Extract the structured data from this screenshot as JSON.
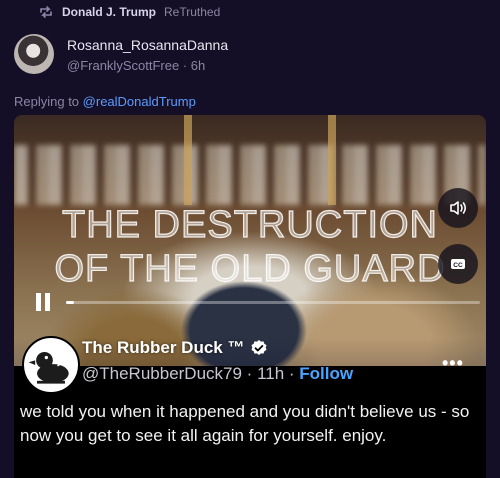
{
  "retruth": {
    "icon": "retruth-icon",
    "name": "Donald J. Trump",
    "verb": "ReTruthed"
  },
  "author": {
    "display_name": "Rosanna_RosannaDanna",
    "handle": "@FranklyScottFree",
    "time": "6h",
    "handle_time": "@FranklyScottFree · 6h"
  },
  "reply": {
    "prefix": "Replying to",
    "mention": "@realDonaldTrump"
  },
  "video": {
    "overlay_line1": "THE DESTRUCTION",
    "overlay_line2": "OF THE OLD GUARD",
    "mute_icon": "speaker-icon",
    "cc_label": "CC",
    "progress_fraction": 0.02
  },
  "embedded_card": {
    "name": "The Rubber Duck ™",
    "handle": "@TheRubberDuck79",
    "separator": " · ",
    "time": "11h",
    "follow_label": "Follow",
    "more_label": "•••",
    "text": "we told you when it happened and you didn't believe us - so now you get to see it all again for yourself. enjoy."
  },
  "colors": {
    "background": "#140f26",
    "link": "#5b9bff",
    "follow": "#4aa3ff"
  }
}
